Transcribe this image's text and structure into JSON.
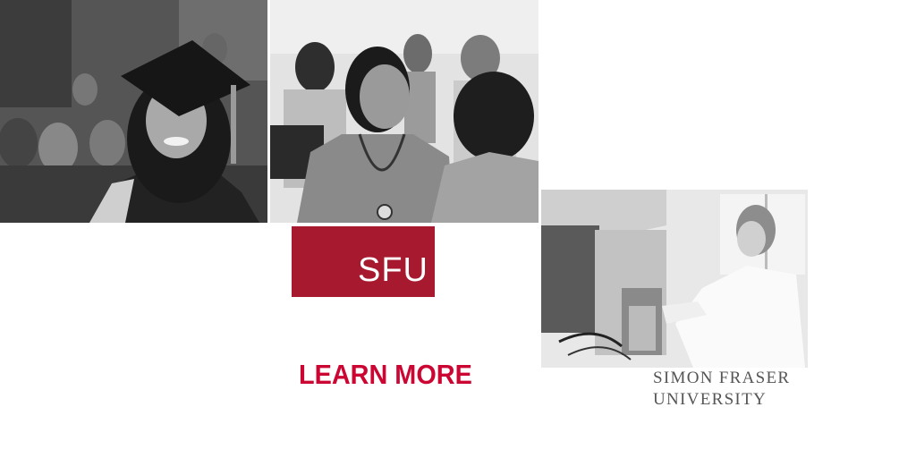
{
  "logo": {
    "text": "SFU",
    "color": "#a6192e"
  },
  "cta": {
    "label": "LEARN MORE",
    "color": "#cc0633"
  },
  "university": {
    "line1": "SIMON FRASER",
    "line2": "UNIVERSITY"
  },
  "photos": [
    {
      "subject": "graduate in cap and gown"
    },
    {
      "subject": "nursing student with stethoscope"
    },
    {
      "subject": "researcher in laboratory"
    }
  ]
}
